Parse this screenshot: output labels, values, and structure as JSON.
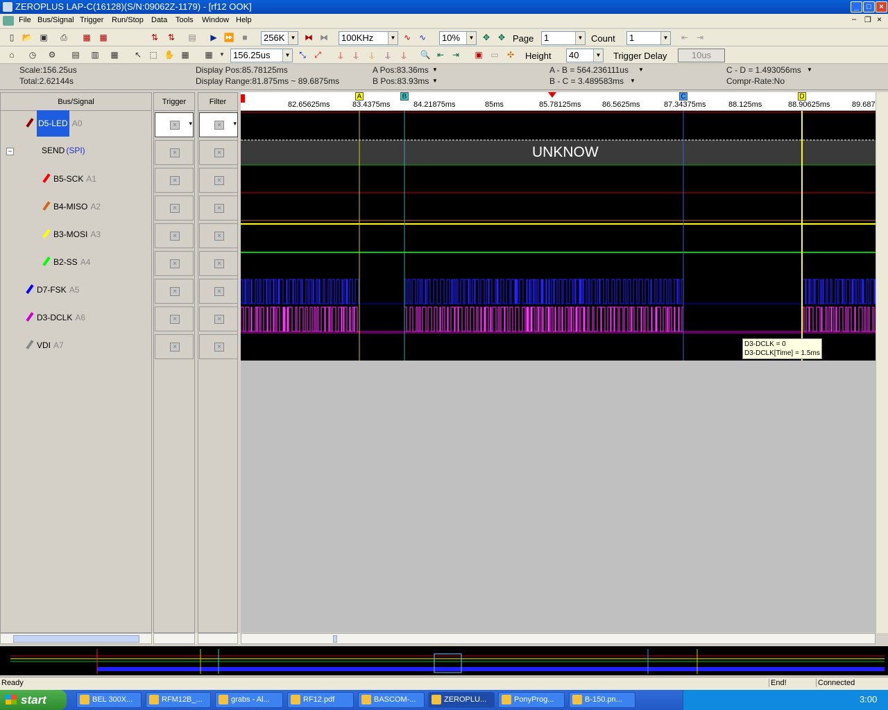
{
  "window": {
    "title": "ZEROPLUS LAP-C(16128)(S/N:09062Z-1179) - [rf12 OOK]"
  },
  "menu": [
    "File",
    "Bus/Signal",
    "Trigger",
    "Run/Stop",
    "Data",
    "Tools",
    "Window",
    "Help"
  ],
  "toolbar1": {
    "memory": "256K",
    "frequency": "100KHz",
    "trigger_pos": "10%",
    "page_label": "Page",
    "page_value": "1",
    "count_label": "Count",
    "count_value": "1"
  },
  "toolbar2": {
    "scale_value": "156.25us",
    "height_label": "Height",
    "height_value": "40",
    "trigger_delay_label": "Trigger Delay",
    "trigger_delay_value": "10us"
  },
  "info": {
    "scale": "Scale:156.25us",
    "total": "Total:2.62144s",
    "display_pos": "Display Pos:85.78125ms",
    "display_range": "Display Range:81.875ms ~ 89.6875ms",
    "a_pos": "A Pos:83.36ms",
    "b_pos": "B Pos:83.93ms",
    "a_b": "A - B = 564.236111us",
    "b_c": "B - C = 3.489583ms",
    "c_d": "C - D = 1.493056ms",
    "compr": "Compr-Rate:No"
  },
  "columns": {
    "bus_signal": "Bus/Signal",
    "trigger": "Trigger",
    "filter": "Filter"
  },
  "signals": [
    {
      "name": "D5-LED",
      "ch": "A0",
      "color": "#8b0000"
    },
    {
      "name": "SEND",
      "ch": "(SPI)",
      "color": "#888888"
    },
    {
      "name": "B5-SCK",
      "ch": "A1",
      "color": "#ff0000"
    },
    {
      "name": "B4-MISO",
      "ch": "A2",
      "color": "#d2691e"
    },
    {
      "name": "B3-MOSI",
      "ch": "A3",
      "color": "#ffff00"
    },
    {
      "name": "B2-SS",
      "ch": "A4",
      "color": "#00ff00"
    },
    {
      "name": "D7-FSK",
      "ch": "A5",
      "color": "#0000ff"
    },
    {
      "name": "D3-DCLK",
      "ch": "A6",
      "color": "#cc00cc"
    },
    {
      "name": "VDI",
      "ch": "A7",
      "color": "#888888"
    }
  ],
  "ruler_ticks": [
    "82.65625ms",
    "83.4375ms",
    "84.21875ms",
    "85ms",
    "85.78125ms",
    "86.5625ms",
    "87.34375ms",
    "88.125ms",
    "88.90625ms",
    "89.687"
  ],
  "cursor_labels": {
    "a": "A",
    "b": "B",
    "c": "C",
    "d": "D"
  },
  "bus_decode": "UNKNOW",
  "tooltip": {
    "line1": "D3-DCLK = 0",
    "line2": "D3-DCLK[Time] = 1.5ms"
  },
  "status": {
    "left": "Ready",
    "end": "End!",
    "conn": "Connected"
  },
  "taskbar": {
    "start": "start",
    "tasks": [
      "BEL 300X...",
      "RFM12B_...",
      "grabs - Al...",
      "RF12.pdf",
      "BASCOM-...",
      "ZEROPLU...",
      "PonyProg...",
      "B-150.pn..."
    ],
    "clock": "3:00"
  }
}
